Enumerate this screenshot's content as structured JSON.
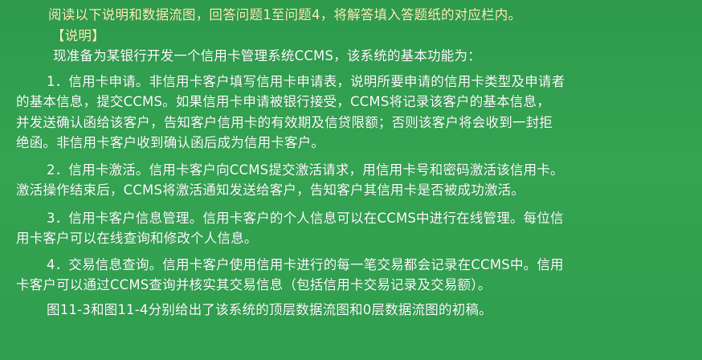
{
  "header": {
    "intro": "阅读以下说明和数据流图，回答问题1至问题4，将解答填入答题纸的对应栏内。",
    "section_label": "【说明】"
  },
  "body": {
    "lead": "现准备为某银行开发一个信用卡管理系统CCMS，该系统的基本功能为：",
    "item1": [
      "1．信用卡申请。非信用卡客户填写信用卡申请表，说明所要申请的信用卡类型及申请者",
      "的基本信息，提交CCMS。如果信用卡申请被银行接受，CCMS将记录该客户的基本信息，",
      "并发送确认函给该客户，告知客户信用卡的有效期及信贷限额；否则该客户将会收到一封拒",
      "绝函。非信用卡客户收到确认函后成为信用卡客户。"
    ],
    "item2": [
      "2．信用卡激活。信用卡客户向CCMS提交激活请求，用信用卡号和密码激活该信用卡。",
      "激活操作结束后，CCMS将激活通知发送给客户，告知客户其信用卡是否被成功激活。"
    ],
    "item3": [
      "3．信用卡客户信息管理。信用卡客户的个人信息可以在CCMS中进行在线管理。每位信",
      "用卡客户可以在线查询和修改个人信息。"
    ],
    "item4": [
      "4．交易信息查询。信用卡客户使用信用卡进行的每一笔交易都会记录在CCMS中。信用",
      "卡客户可以通过CCMS查询并核实其交易信息（包括信用卡交易记录及交易额）。"
    ],
    "closing": "图11-3和图11-4分别给出了该系统的顶层数据流图和0层数据流图的初稿。"
  },
  "colors": {
    "background": "#2e9d4e",
    "text": "#ffffff",
    "heading_text": "#fff3b8"
  }
}
